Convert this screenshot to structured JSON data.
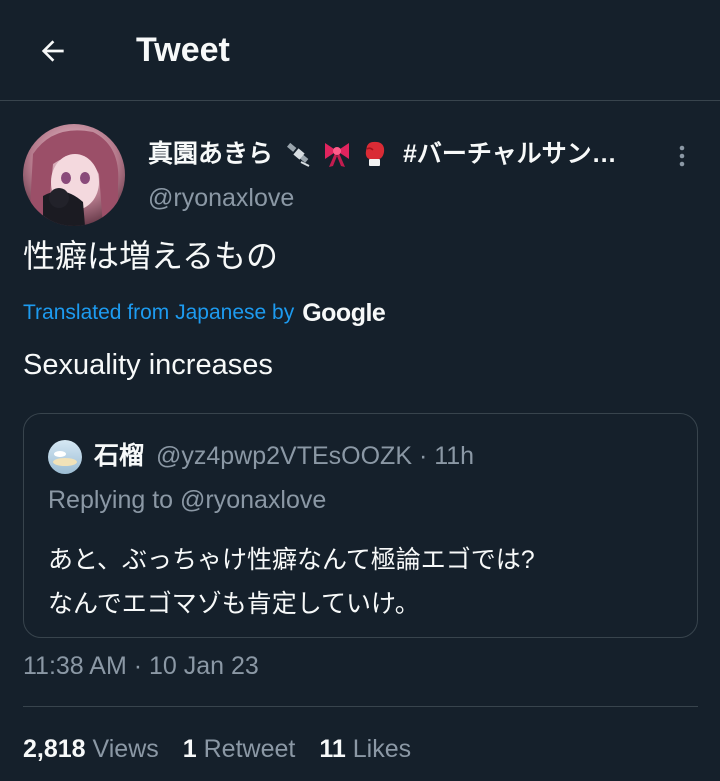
{
  "header": {
    "title": "Tweet",
    "back_icon": "arrow-left-icon"
  },
  "author": {
    "display_name": "真園あきら",
    "name_suffix": "#バーチャルサン…",
    "emojis": [
      "satellite-icon",
      "ribbon-icon",
      "boxing-glove-icon"
    ],
    "handle": "@ryonaxlove"
  },
  "tweet": {
    "text": "性癖は増えるもの",
    "translated_label": "Translated from Japanese by",
    "translator": "Google",
    "translation": "Sexuality increases"
  },
  "quote": {
    "name": "石榴",
    "handle_time": "@yz4pwp2VTEsOOZK · 11h",
    "replying_to": "Replying to @ryonaxlove",
    "line1": "あと、ぶっちゃけ性癖なんて極論エゴでは?",
    "line2": "なんでエゴマゾも肯定していけ。"
  },
  "timestamp": "11:38 AM · 10 Jan 23",
  "stats": {
    "views_count": "2,818",
    "views_label": "Views",
    "retweets_count": "1",
    "retweets_label": "Retweet",
    "likes_count": "11",
    "likes_label": "Likes"
  },
  "colors": {
    "background": "#15202b",
    "accent": "#1d9bf0",
    "secondary_text": "#8b98a5",
    "border": "#38444d"
  }
}
